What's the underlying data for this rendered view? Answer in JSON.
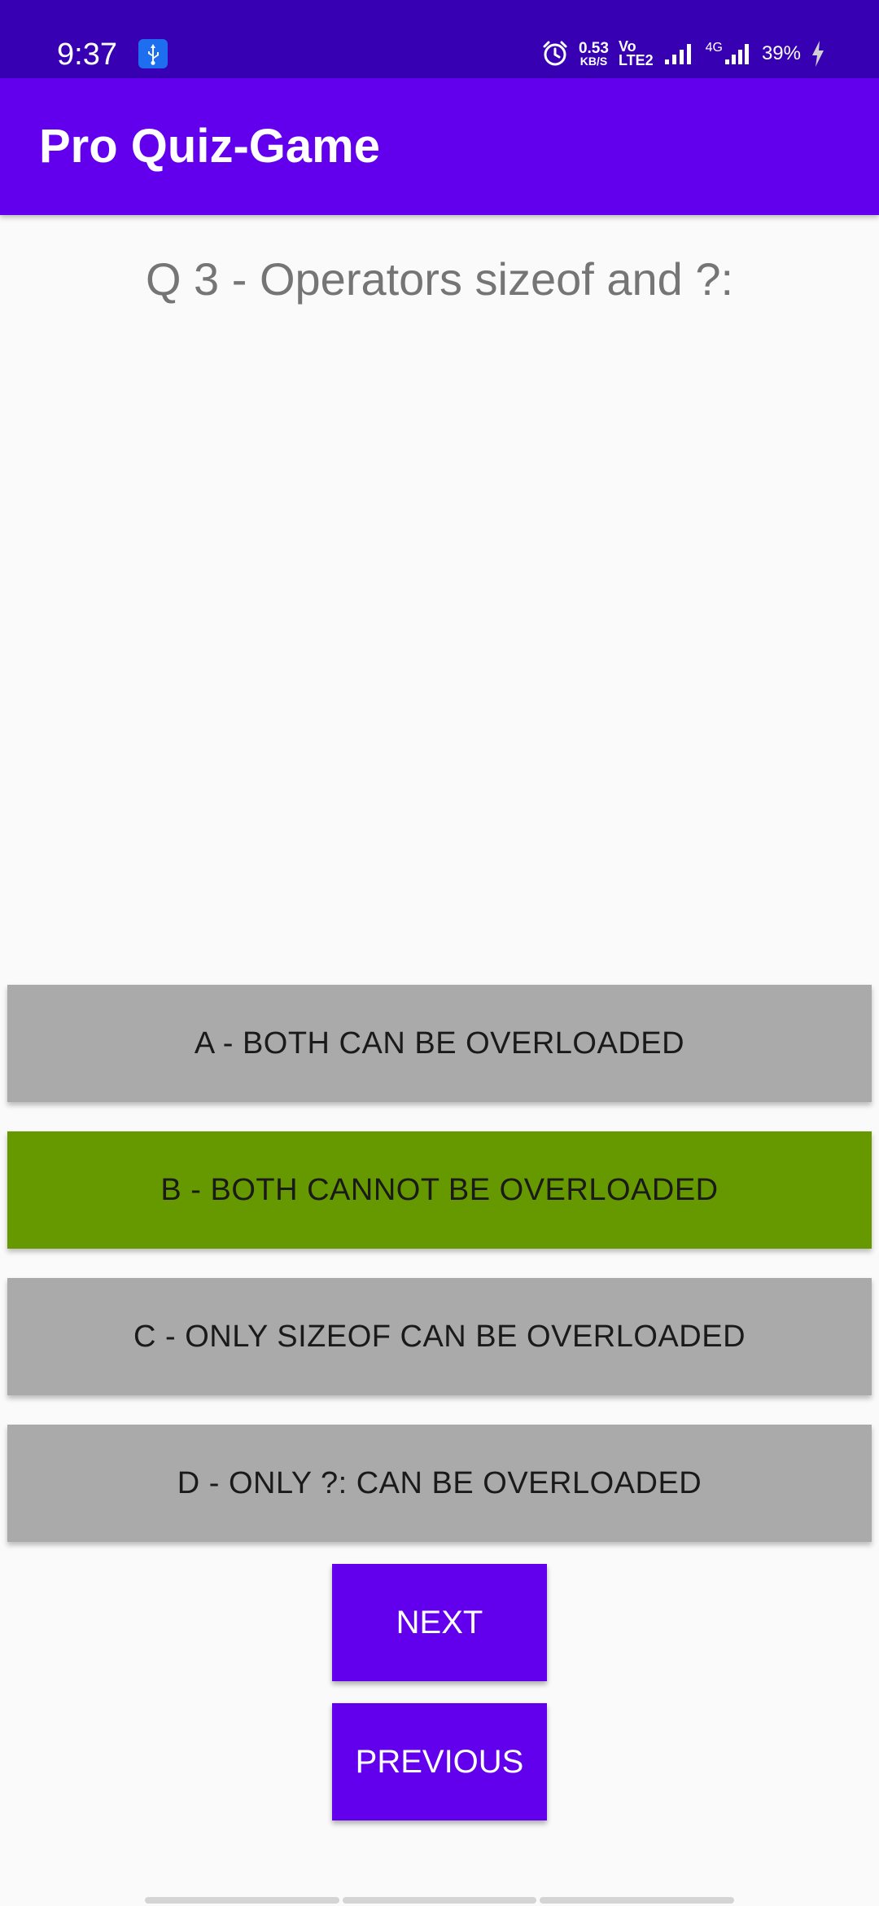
{
  "status_bar": {
    "time": "9:37",
    "net_speed": "0.53",
    "net_speed_unit": "KB/S",
    "volte_top": "Vo",
    "volte_bottom": "LTE2",
    "network_type": "4G",
    "battery": "39%",
    "colors": {
      "background": "#3700b3",
      "usb_badge": "#1e6ff0"
    },
    "icons": [
      "usb-icon",
      "alarm-icon",
      "signal-icon",
      "signal-4g-icon",
      "charging-bolt-icon"
    ]
  },
  "app_bar": {
    "title": "Pro Quiz-Game",
    "color": "#6200ee"
  },
  "question": {
    "text": "Q 3 - Operators sizeof and ?:"
  },
  "options": [
    {
      "label": "A - BOTH CAN BE OVERLOADED",
      "state": "default",
      "color": "#aaaaaa"
    },
    {
      "label": "B - BOTH CANNOT BE OVERLOADED",
      "state": "correct",
      "color": "#669900"
    },
    {
      "label": "C - ONLY SIZEOF CAN BE OVERLOADED",
      "state": "default",
      "color": "#aaaaaa"
    },
    {
      "label": "D - ONLY ?: CAN BE OVERLOADED",
      "state": "default",
      "color": "#aaaaaa"
    }
  ],
  "navigation": {
    "next_label": "NEXT",
    "previous_label": "PREVIOUS",
    "color": "#6200ee"
  }
}
